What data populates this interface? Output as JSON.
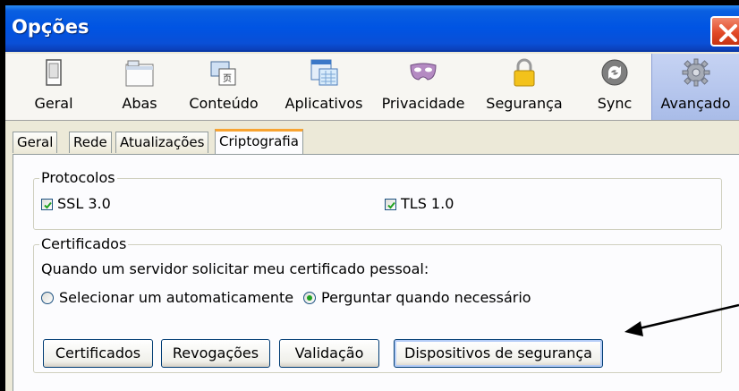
{
  "window": {
    "title": "Opções",
    "close_icon": "close-x-icon",
    "accent": "#0054e3"
  },
  "toolbar": {
    "items": [
      {
        "label": "Geral",
        "icon": "general-icon"
      },
      {
        "label": "Abas",
        "icon": "tabs-icon"
      },
      {
        "label": "Conteúdo",
        "icon": "content-icon"
      },
      {
        "label": "Aplicativos",
        "icon": "applications-icon"
      },
      {
        "label": "Privacidade",
        "icon": "privacy-mask-icon"
      },
      {
        "label": "Segurança",
        "icon": "security-lock-icon"
      },
      {
        "label": "Sync",
        "icon": "sync-icon"
      },
      {
        "label": "Avançado",
        "icon": "advanced-gear-icon",
        "selected": true
      }
    ]
  },
  "tabs": [
    {
      "label": "Geral"
    },
    {
      "label": "Rede"
    },
    {
      "label": "Atualizações"
    },
    {
      "label": "Criptografia",
      "selected": true
    }
  ],
  "protocols": {
    "legend": "Protocolos",
    "ssl": {
      "label": "SSL 3.0",
      "checked": true
    },
    "tls": {
      "label": "TLS 1.0",
      "checked": true
    }
  },
  "certificates": {
    "legend": "Certificados",
    "prompt": "Quando um servidor solicitar meu certificado pessoal:",
    "option_auto": {
      "label": "Selecionar um automaticamente",
      "selected": false
    },
    "option_ask": {
      "label": "Perguntar quando necessário",
      "selected": true
    },
    "buttons": {
      "certificates": "Certificados",
      "revocations": "Revogações",
      "validation": "Validação",
      "security_devices": "Dispositivos de segurança"
    }
  },
  "annotation": {
    "icon": "pointer-arrow-icon"
  }
}
